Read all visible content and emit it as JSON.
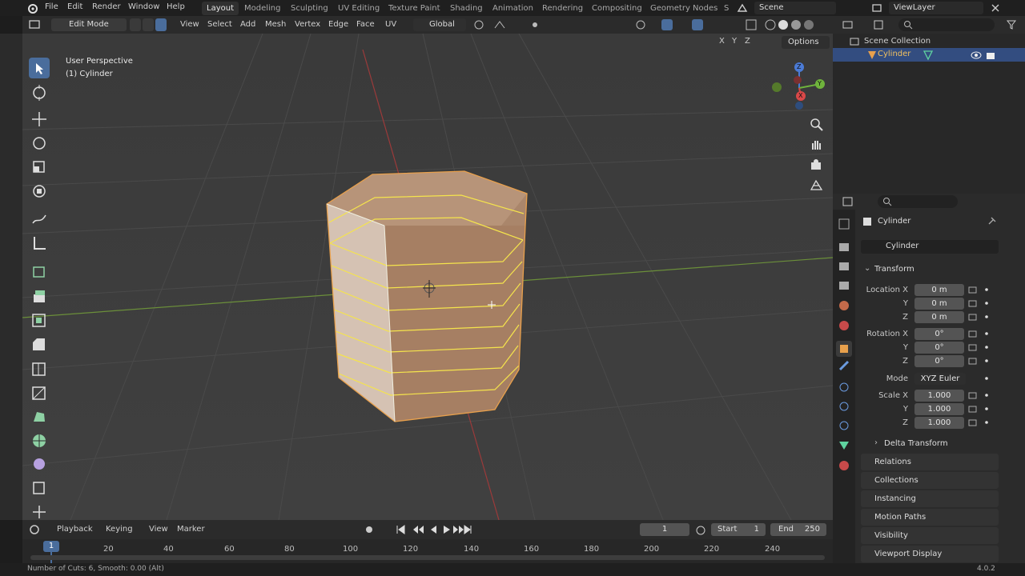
{
  "menu": {
    "file": "File",
    "edit": "Edit",
    "render": "Render",
    "window": "Window",
    "help": "Help"
  },
  "workspaces": [
    "Layout",
    "Modeling",
    "Sculpting",
    "UV Editing",
    "Texture Paint",
    "Shading",
    "Animation",
    "Rendering",
    "Compositing",
    "Geometry Nodes",
    "S"
  ],
  "scene": "Scene",
  "view_layer": "ViewLayer",
  "header": {
    "mode": "Edit Mode",
    "view": "View",
    "select": "Select",
    "add": "Add",
    "mesh": "Mesh",
    "vertex": "Vertex",
    "edge": "Edge",
    "face": "Face",
    "uv": "UV",
    "orientation": "Global",
    "options": "Options",
    "x": "X",
    "y": "Y",
    "z": "Z"
  },
  "viewport": {
    "perspective": "User Perspective",
    "object": "(1) Cylinder"
  },
  "gizmo": {
    "x": "X",
    "y": "Y",
    "z": "Z"
  },
  "outliner": {
    "collection": "Scene Collection",
    "object": "Cylinder"
  },
  "properties": {
    "object_name": "Cylinder",
    "data_name": "Cylinder",
    "transform": "Transform",
    "location_label": "Location X",
    "loc_y_label": "Y",
    "loc_z_label": "Z",
    "location": [
      "0 m",
      "0 m",
      "0 m"
    ],
    "rotation_label": "Rotation X",
    "rot_y_label": "Y",
    "rot_z_label": "Z",
    "rotation": [
      "0°",
      "0°",
      "0°"
    ],
    "mode_label": "Mode",
    "mode_value": "XYZ Euler",
    "scale_label": "Scale X",
    "scale_y_label": "Y",
    "scale_z_label": "Z",
    "scale": [
      "1.000",
      "1.000",
      "1.000"
    ],
    "delta": "Delta Transform",
    "sections": [
      "Relations",
      "Collections",
      "Instancing",
      "Motion Paths",
      "Visibility",
      "Viewport Display"
    ]
  },
  "timeline": {
    "playback": "Playback",
    "keying": "Keying",
    "view": "View",
    "marker": "Marker",
    "current": "1",
    "start_label": "Start",
    "start": "1",
    "end_label": "End",
    "end": "250",
    "ticks": [
      "20",
      "40",
      "60",
      "80",
      "100",
      "120",
      "140",
      "160",
      "180",
      "200",
      "220",
      "240"
    ],
    "frame_badge": "1"
  },
  "status": {
    "text": "Number of Cuts: 6, Smooth: 0.00 (Alt)",
    "version": "4.0.2"
  },
  "colors": {
    "accent": "#4a6d9c",
    "selection": "#e8a04c",
    "edge_highlight": "#f5e44c"
  }
}
